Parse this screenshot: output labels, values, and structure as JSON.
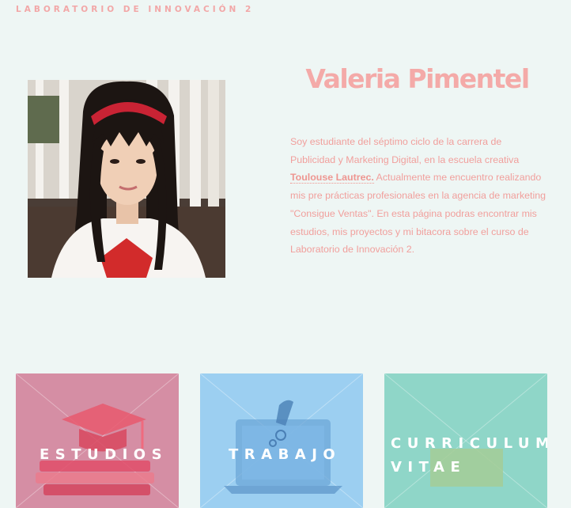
{
  "header": {
    "site_title": "LABORATORIO DE INNOVACIÓN 2"
  },
  "profile": {
    "name": "Valeria Pimentel",
    "bio_part1": "Soy estudiante del séptimo ciclo de la carrera de Publicidad y Marketing Digital, en la escuela creativa ",
    "bio_brand": "Toulouse Lautrec.",
    "bio_part2": " Actualmente me encuentro realizando mis pre prácticas profesionales en la agencia de marketing \"Consigue Ventas\". En esta página podras encontrar mis estudios, mis proyectos y mi bitacora sobre el curso de Laboratorio de Innovación 2."
  },
  "cards": [
    {
      "label": "ESTUDIOS",
      "color": "#d58ea4",
      "icon": "graduation-cap-books-icon"
    },
    {
      "label": "TRABAJO",
      "color": "#9ccff1",
      "icon": "laptop-rocket-icon"
    },
    {
      "label_line1": "CURRICULUM",
      "label_line2": "VITAE",
      "color": "#8fd6c8",
      "icon": "document-icon"
    }
  ],
  "colors": {
    "accent": "#f4aaa8",
    "background": "#eef6f4"
  }
}
